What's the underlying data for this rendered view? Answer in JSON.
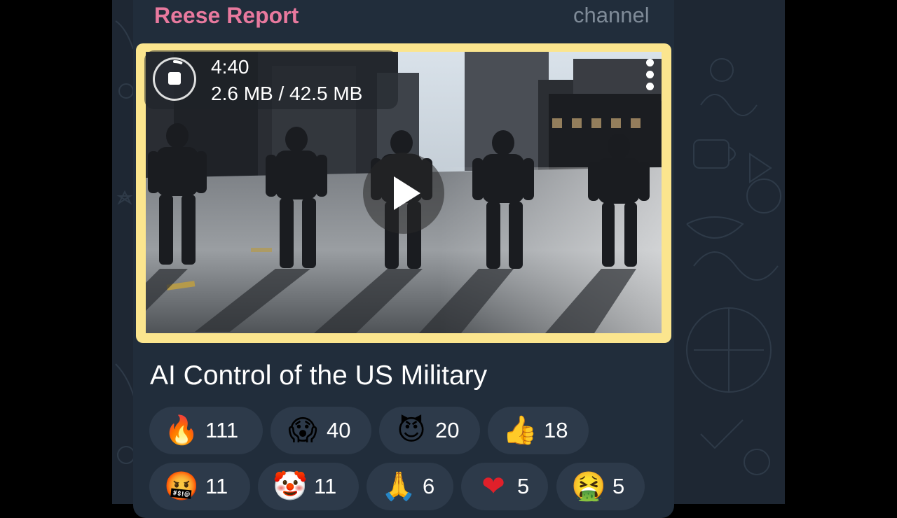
{
  "channel": {
    "name": "Reese Report",
    "tag": "channel"
  },
  "video": {
    "duration": "4:40",
    "download_progress": "2.6 MB / 42.5 MB",
    "download_fraction": 0.061
  },
  "post": {
    "caption": "AI Control of the US Military"
  },
  "reactions": [
    {
      "emoji": "🔥",
      "icon": "fire-emoji",
      "count": "111"
    },
    {
      "emoji": "😱",
      "icon": "screaming-face-emoji",
      "count": "40"
    },
    {
      "emoji": "😈",
      "icon": "smiling-devil-emoji",
      "count": "20"
    },
    {
      "emoji": "👍",
      "icon": "thumbs-up-emoji",
      "count": "18"
    },
    {
      "emoji": "🤬",
      "icon": "cursing-face-emoji",
      "count": "11"
    },
    {
      "emoji": "🤡",
      "icon": "clown-face-emoji",
      "count": "11"
    },
    {
      "emoji": "🙏",
      "icon": "folded-hands-emoji",
      "count": "6"
    },
    {
      "emoji": "❤",
      "icon": "red-heart-emoji",
      "count": "5"
    },
    {
      "emoji": "🤮",
      "icon": "vomiting-face-emoji",
      "count": "5"
    }
  ],
  "colors": {
    "accent_name": "#e8799e",
    "bubble": "#212d3b",
    "reaction_bg": "#2d3a4a",
    "frame_highlight": "#fbe58e"
  }
}
